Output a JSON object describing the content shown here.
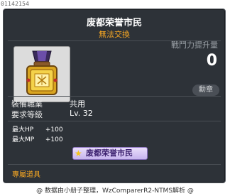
{
  "item_id": "01142154",
  "title": "废都荣誉市民",
  "subtitle": "無法交換",
  "power": {
    "label": "戰鬥力提升量",
    "value": "0"
  },
  "medal_button": "勳章",
  "info": [
    {
      "label": "裝備職業",
      "value": "共用"
    },
    {
      "label": "要求等級",
      "value": "Lv. 32"
    }
  ],
  "stats": [
    {
      "label": "最大HP",
      "value": "+100"
    },
    {
      "label": "最大MP",
      "value": "+100"
    }
  ],
  "badge_text": "废都荣誉市民",
  "exclusive": "專屬道具",
  "footer": "@ 数据由小册子整理，WzComparerR2-NTMS解析 @",
  "colors": {
    "panel": "#2d3238",
    "accent_orange": "#f5a623",
    "badge_purple": "#c7b4ee"
  },
  "icons": {
    "item": "medal-icon",
    "badge_star": "star-icon"
  }
}
